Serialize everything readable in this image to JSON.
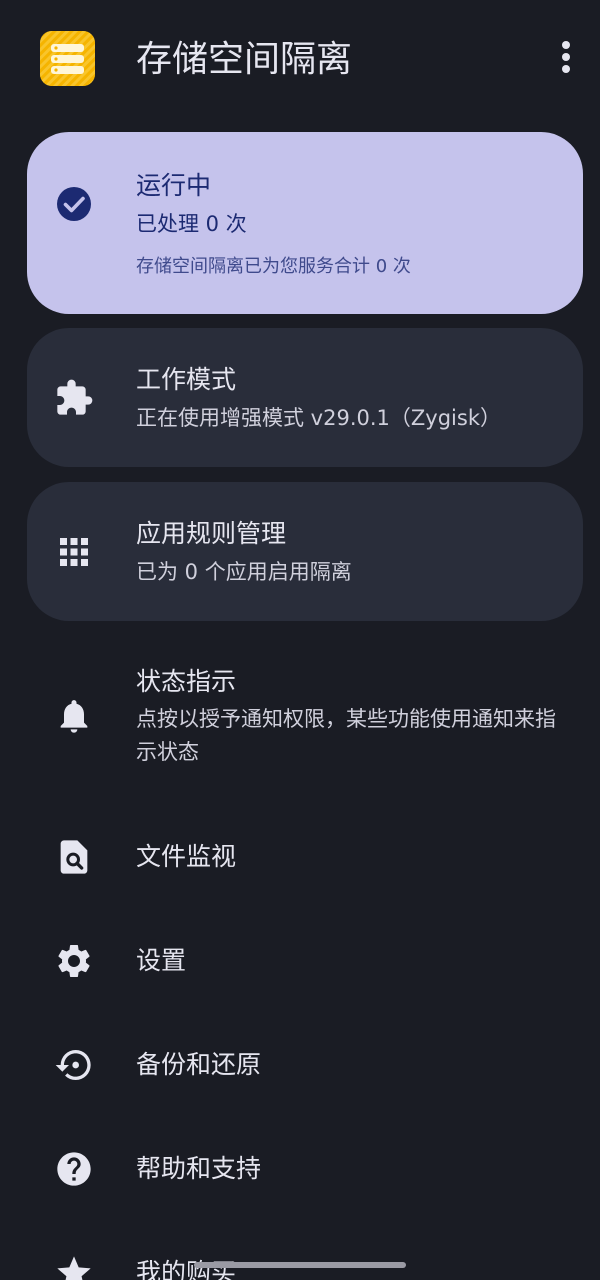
{
  "app": {
    "title": "存储空间隔离",
    "icon": "storage-isolation-app-icon",
    "accent": "#f5b400"
  },
  "status_card": {
    "title": "运行中",
    "subtitle": "已处理 0 次",
    "note": "存储空间隔离已为您服务合计 0 次",
    "icon": "check-circle-icon",
    "background": "#c5c3ec"
  },
  "mode_card": {
    "title": "工作模式",
    "subtitle": "正在使用增强模式 v29.0.1（Zygisk）",
    "icon": "puzzle-icon"
  },
  "rules_card": {
    "title": "应用规则管理",
    "subtitle": "已为 0 个应用启用隔离",
    "icon": "apps-grid-icon"
  },
  "menu": {
    "status_indicator": {
      "title": "状态指示",
      "subtitle": "点按以授予通知权限，某些功能使用通知来指示状态",
      "icon": "bell-icon"
    },
    "file_monitor": {
      "title": "文件监视",
      "icon": "file-search-icon"
    },
    "settings": {
      "title": "设置",
      "icon": "gear-icon"
    },
    "backup": {
      "title": "备份和还原",
      "icon": "restore-icon"
    },
    "help": {
      "title": "帮助和支持",
      "icon": "help-icon"
    },
    "purchase": {
      "title": "我的购买",
      "icon": "star-icon"
    }
  }
}
